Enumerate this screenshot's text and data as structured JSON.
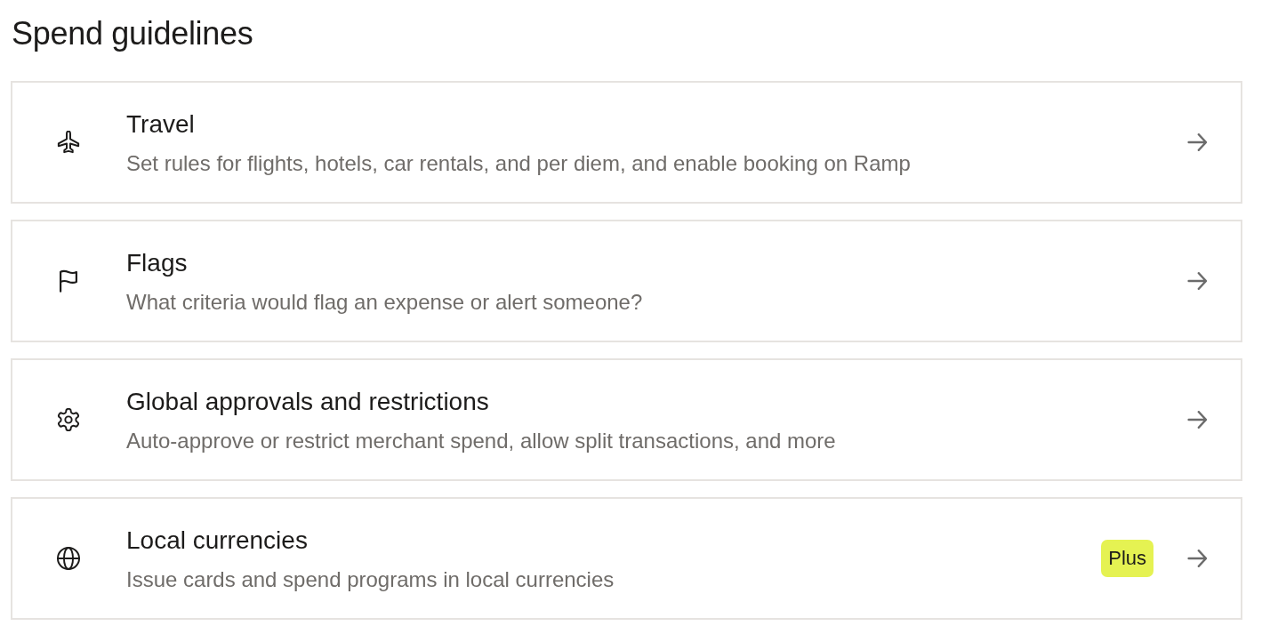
{
  "heading": "Spend guidelines",
  "items": [
    {
      "title": "Travel",
      "description": "Set rules for flights, hotels, car rentals, and per diem, and enable booking on Ramp"
    },
    {
      "title": "Flags",
      "description": "What criteria would flag an expense or alert someone?"
    },
    {
      "title": "Global approvals and restrictions",
      "description": "Auto-approve or restrict merchant spend, allow split transactions, and more"
    },
    {
      "title": "Local currencies",
      "description": "Issue cards and spend programs in local currencies",
      "badge": "Plus"
    }
  ]
}
